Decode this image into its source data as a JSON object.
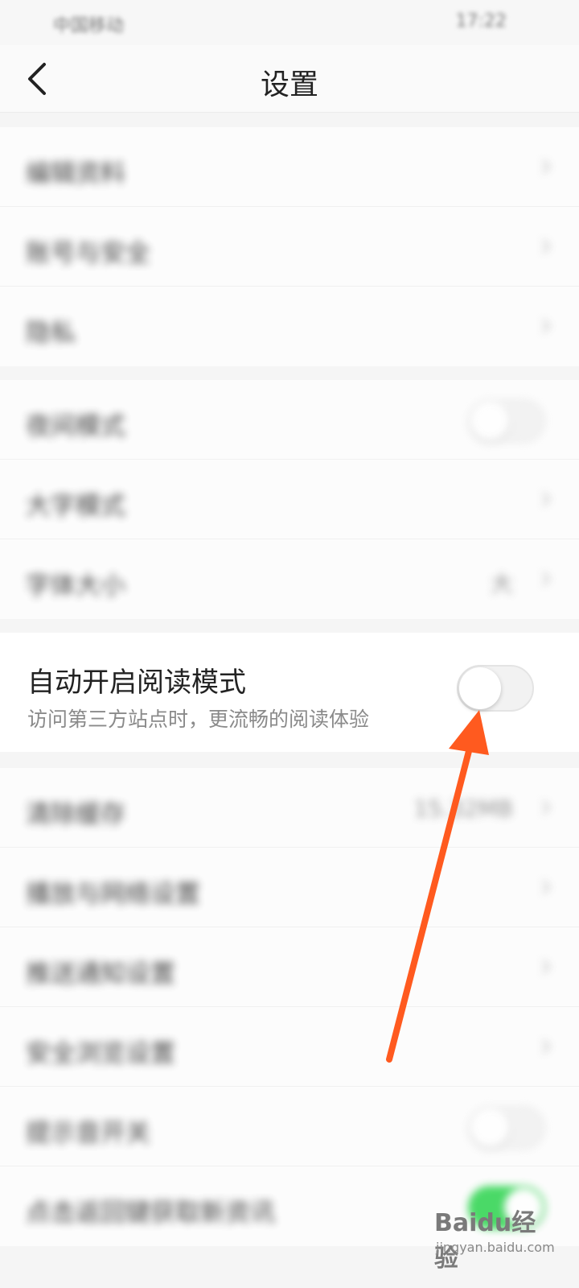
{
  "status_bar": {
    "carrier": "中国移动",
    "signal_text": "ᵃˡˡ",
    "time": "17:22"
  },
  "header": {
    "title": "设置"
  },
  "group1": [
    {
      "label": "编辑资料"
    },
    {
      "label": "账号与安全"
    },
    {
      "label": "隐私"
    }
  ],
  "group2": [
    {
      "label": "夜间模式",
      "toggle": "off"
    },
    {
      "label": "大字模式"
    },
    {
      "label": "字体大小",
      "value": "大"
    }
  ],
  "reading_mode": {
    "title": "自动开启阅读模式",
    "subtitle": "访问第三方站点时，更流畅的阅读体验",
    "toggle": "off"
  },
  "group3": [
    {
      "label": "清除缓存",
      "value": "15.32MB"
    },
    {
      "label": "播放与网络设置"
    },
    {
      "label": "推送通知设置"
    },
    {
      "label": "安全浏览设置"
    },
    {
      "label": "提示音开关",
      "toggle": "off"
    },
    {
      "label": "点击返回键获取新资讯",
      "toggle": "on"
    }
  ],
  "watermark": {
    "brand": "Baidu经验",
    "url": "jingyan.baidu.com"
  },
  "colors": {
    "annotation_arrow": "#ff5a1f",
    "toggle_on": "#37d657"
  }
}
